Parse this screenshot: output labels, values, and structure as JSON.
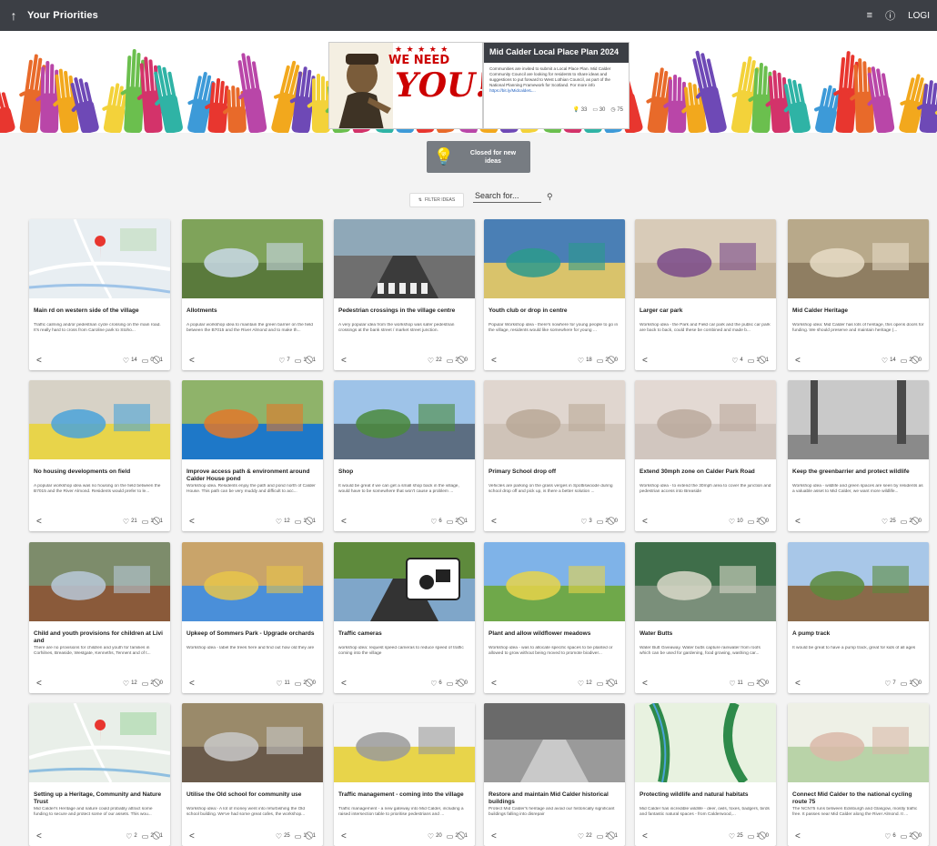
{
  "topbar": {
    "back_icon": "arrow-up-icon",
    "title": "Your Priorities",
    "menu_icon": "hamburger-icon",
    "help_icon": "help-circle-icon",
    "login_label": "LOGI"
  },
  "banner": {
    "poster_we_need": "WE NEED",
    "poster_you": "YOU!",
    "card_title": "Mid Calder Local Place Plan 2024",
    "card_body": "Communities are invited to submit a Local Place Plan. Mid Calder Community Council are looking for residents to share ideas and suggestions to put forward to West Lothian Council, as part of the National Planning Framework for Scotland. For more info",
    "card_link": "https://bit.ly/MidcalderL...",
    "stats": {
      "ideas": "33",
      "comments": "30",
      "users": "75"
    }
  },
  "closed_button": {
    "label": "Closed for new ideas",
    "icon": "lightbulb-icon"
  },
  "filter_button": {
    "label": "FILTER IDEAS",
    "icon": "sort-icon"
  },
  "search": {
    "placeholder": "Search for...",
    "icon": "search-icon"
  },
  "colors": {
    "topbar": "#3c3f45",
    "closed_button": "#777c82",
    "background": "#f3f3f3"
  },
  "cards": [
    {
      "title": "Main rd on western side of the village",
      "desc": "Traffic calming and/or pedestrian cycle crossing on the main road. It's really hard to cross from Caroline park to Stoho...",
      "likes": "14",
      "comments": "0",
      "flags": "1",
      "image": "map"
    },
    {
      "title": "Allotments",
      "desc": "A popular workshop idea to maintain the green barrier on the field between the B7015 and the River Almond and to make th...",
      "likes": "7",
      "comments": "1",
      "flags": "1",
      "image": "allotment"
    },
    {
      "title": "Pedestrian crossings in the village centre",
      "desc": "A very popular idea from the workshop was safer pedestrian crossings at the bank street / market street junction.",
      "likes": "22",
      "comments": "2",
      "flags": "0",
      "image": "crossing"
    },
    {
      "title": "Youth club or drop in centre",
      "desc": "Popular Workshop idea - there's nowhere for young people to go in the village, residents would like somewhere for young ...",
      "likes": "18",
      "comments": "2",
      "flags": "0",
      "image": "youth"
    },
    {
      "title": "Larger car park",
      "desc": "Workshop idea - the Park and Field car park and the public car park are back to back, could these be combined and made b...",
      "likes": "4",
      "comments": "1",
      "flags": "1",
      "image": "carpark"
    },
    {
      "title": "Mid Calder Heritage",
      "desc": "Workshop idea: Mid Calder has lots of heritage, this opens doors for funding. We should preserve and maintain heritage (...",
      "likes": "14",
      "comments": "2",
      "flags": "0",
      "image": "heritage"
    },
    {
      "title": "No housing developments on field",
      "desc": "A popular workshop idea was no housing on the field between the B7015 and the River Almond. Residents would prefer to le...",
      "likes": "21",
      "comments": "1",
      "flags": "1",
      "image": "notes"
    },
    {
      "title": "Improve access path & environment around Calder House pond",
      "desc": "Workshop idea. Residents enjoy the path and pond north of Calder House. This path can be very muddy and difficult to acc...",
      "likes": "12",
      "comments": "1",
      "flags": "1",
      "image": "kingfisher"
    },
    {
      "title": "Shop",
      "desc": "It would be great if we can get a small shop back in the village, would have to be somewhere that won't cause a problem ...",
      "likes": "6",
      "comments": "2",
      "flags": "1",
      "image": "shop"
    },
    {
      "title": "Primary School drop off",
      "desc": "Vehicles are parking on the grass verges in Spottiswoode during school drop off and pick up, is there a better solution ...",
      "likes": "3",
      "comments": "2",
      "flags": "0",
      "image": "plan"
    },
    {
      "title": "Extend 30mph zone on Calder Park Road",
      "desc": "Workshop idea - to extend the 30mph area to cover the junction and pedestrian access into Breaside",
      "likes": "10",
      "comments": "2",
      "flags": "0",
      "image": "plan2"
    },
    {
      "title": "Keep the greenbarrier and protect wildlife",
      "desc": "Workshop idea - wildlife and green spaces are seen by residents as a valuable asset to Mid Calder, we want more wildlife...",
      "likes": "25",
      "comments": "2",
      "flags": "0",
      "image": "trees"
    },
    {
      "title": "Child and youth provisions for children at Livi and",
      "desc": "There are no provisions for children and youth for families in Corhilnes, Breaside, Westgate, Kenneths, Tennent and of t...",
      "likes": "12",
      "comments": "2",
      "flags": "0",
      "image": "playground"
    },
    {
      "title": "Upkeep of Sommers Park - Upgrade orchards",
      "desc": "Workshop idea - label the trees here and find out how old they are",
      "likes": "11",
      "comments": "2",
      "flags": "0",
      "image": "sticky"
    },
    {
      "title": "Traffic cameras",
      "desc": "workshop idea: request speed cameras to reduce speed of traffic coming into the village",
      "likes": "6",
      "comments": "2",
      "flags": "0",
      "image": "camera"
    },
    {
      "title": "Plant and allow wildflower meadows",
      "desc": "Workshop idea - was to allocate specific spaces to be planted or allowed to grow without being moved to promote biodiver...",
      "likes": "12",
      "comments": "1",
      "flags": "1",
      "image": "meadow"
    },
    {
      "title": "Water Butts",
      "desc": "Water Butt Giveaway. Water butts capture rainwater from roofs which can be used for gardening, food growing, washing car...",
      "likes": "11",
      "comments": "2",
      "flags": "0",
      "image": "waterbutt"
    },
    {
      "title": "A pump track",
      "desc": "It would be great to have a pump track, great for kids of all ages",
      "likes": "7",
      "comments": "1",
      "flags": "0",
      "image": "pumptrack"
    },
    {
      "title": "Setting up a Heritage, Community and Nature Trust",
      "desc": "Mid Calder's Heritage and nature could probably attract some funding to secure and protect some of our assets. This wou...",
      "likes": "2",
      "comments": "2",
      "flags": "1",
      "image": "map2"
    },
    {
      "title": "Utilise the Old school for community use",
      "desc": "Workshop idea:- A lot of money went into refurbishing the Old school building. We've had some great cafes, the workshop...",
      "likes": "25",
      "comments": "1",
      "flags": "1",
      "image": "school"
    },
    {
      "title": "Traffic management - coming into the village",
      "desc": "Traffic management - a new gateway into Mid Calder, including a raised intersection table to prioritise pedestrians and ...",
      "likes": "20",
      "comments": "2",
      "flags": "1",
      "image": "sketch"
    },
    {
      "title": "Restore and maintain Mid Calder historical buildings",
      "desc": "Protect Mid Calder's heritage and avoid our historically significant buildings falling into disrepair",
      "likes": "22",
      "comments": "2",
      "flags": "1",
      "image": "street"
    },
    {
      "title": "Protecting wildlife and natural habitats",
      "desc": "Mid Calder has incredible wildlife - deer, owls, foxes, badgers, birds and fantastic natural spaces - from Calderwood,...",
      "likes": "25",
      "comments": "1",
      "flags": "0",
      "image": "greenmap"
    },
    {
      "title": "Connect Mid Calder to the national cycling route 75",
      "desc": "The NCN75 runs between Edinburgh and Glasgow, mostly traffic free. It passes near Mid Calder along the River Almond. It ...",
      "likes": "6",
      "comments": "2",
      "flags": "0",
      "image": "topomap"
    }
  ]
}
